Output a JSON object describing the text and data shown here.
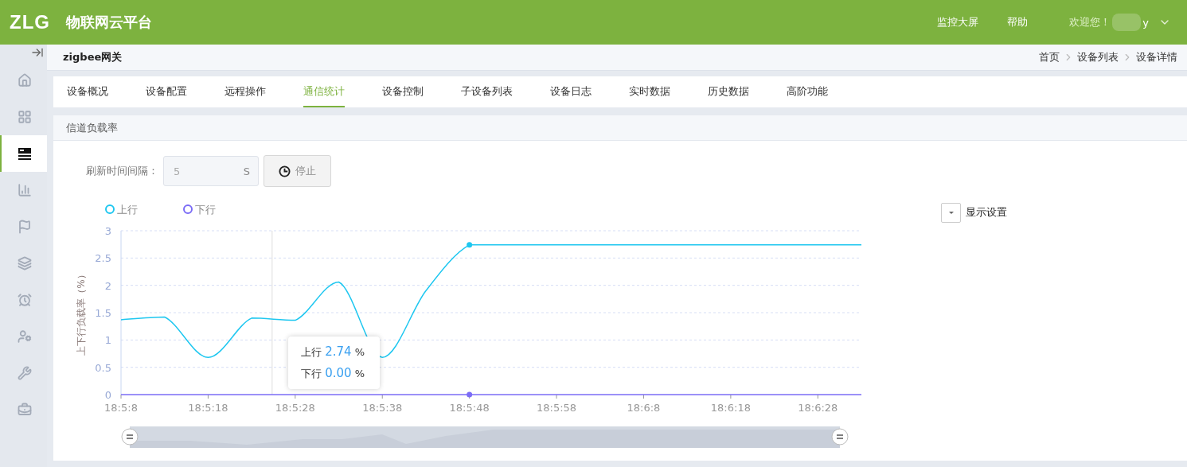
{
  "header": {
    "logo": "ZLG",
    "title": "物联网云平台",
    "links": [
      "监控大屏",
      "帮助"
    ],
    "welcome": "欢迎您！",
    "user": "y"
  },
  "sidebar": {
    "items": [
      {
        "selected": false
      },
      {
        "selected": false
      },
      {
        "selected": true
      },
      {
        "selected": false
      },
      {
        "selected": false
      },
      {
        "selected": false
      },
      {
        "selected": false
      },
      {
        "selected": false
      },
      {
        "selected": false
      },
      {
        "selected": false
      }
    ]
  },
  "page": {
    "title": "zigbee网关",
    "breadcrumb": [
      "首页",
      "设备列表",
      "设备详情"
    ]
  },
  "tabs": [
    {
      "label": "设备概况",
      "selected": false
    },
    {
      "label": "设备配置",
      "selected": false
    },
    {
      "label": "远程操作",
      "selected": false
    },
    {
      "label": "通信统计",
      "selected": true
    },
    {
      "label": "设备控制",
      "selected": false
    },
    {
      "label": "子设备列表",
      "selected": false
    },
    {
      "label": "设备日志",
      "selected": false
    },
    {
      "label": "实时数据",
      "selected": false
    },
    {
      "label": "历史数据",
      "selected": false
    },
    {
      "label": "高阶功能",
      "selected": false
    }
  ],
  "panel": {
    "title": "信道负载率",
    "refresh_label": "刷新时间间隔：",
    "interval": "5",
    "unit": "S",
    "stop_button": "停止",
    "display_settings": "显示设置",
    "chart_data": {
      "type": "line",
      "ylabel": "上下行负载率（%）",
      "categories": [
        "18:5:8",
        null,
        "18:5:18",
        null,
        "18:5:28",
        null,
        "18:5:38",
        null,
        "18:5:48",
        null,
        "18:5:58",
        null,
        "18:6:8",
        null,
        "18:6:18",
        null,
        "18:6:28",
        null
      ],
      "ylim": [
        0,
        3
      ],
      "yticks": [
        0,
        0.5,
        1,
        1.5,
        2,
        2.5,
        3
      ],
      "grid": true,
      "legend": true,
      "series": [
        {
          "name": "上行",
          "color": "#1ec7f0",
          "values": [
            1.37,
            1.42,
            0.68,
            1.4,
            1.36,
            2.06,
            0.68,
            1.9,
            2.74,
            2.74,
            2.74,
            2.74,
            2.74,
            2.74,
            2.74,
            2.74,
            2.74,
            2.74
          ]
        },
        {
          "name": "下行",
          "color": "#7b6cf6",
          "values": [
            0,
            0,
            0,
            0,
            0,
            0,
            0,
            0,
            0,
            0,
            0,
            0,
            0,
            0,
            0,
            0,
            0,
            0
          ]
        }
      ]
    },
    "tooltip": [
      {
        "name": "上行",
        "value": "2.74",
        "unit": "%"
      },
      {
        "name": "下行",
        "value": "0.00",
        "unit": "%"
      }
    ]
  }
}
